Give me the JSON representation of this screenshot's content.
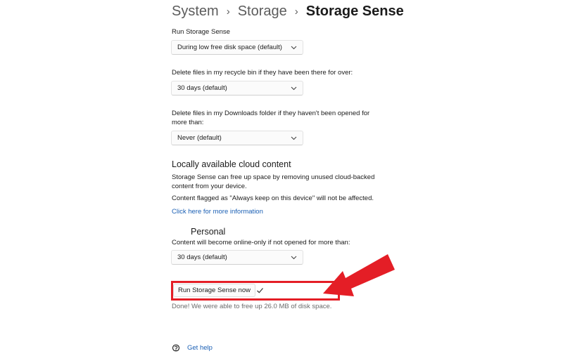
{
  "breadcrumb": {
    "items": [
      "System",
      "Storage"
    ],
    "current": "Storage Sense"
  },
  "run_storage_sense": {
    "label": "Run Storage Sense",
    "value": "During low free disk space (default)"
  },
  "recycle_bin": {
    "label": "Delete files in my recycle bin if they have been there for over:",
    "value": "30 days (default)"
  },
  "downloads": {
    "label_line1": "Delete files in my Downloads folder if they haven't been opened for",
    "label_line2": "more than:",
    "value": "Never (default)"
  },
  "cloud": {
    "title": "Locally available cloud content",
    "desc_line1": "Storage Sense can free up space by removing unused cloud-backed",
    "desc_line2": "content from your device.",
    "note": "Content flagged as \"Always keep on this device\" will not be affected.",
    "link": "Click here for more information"
  },
  "personal": {
    "title": "Personal",
    "label": "Content will become online-only if not opened for more than:",
    "value": "30 days (default)"
  },
  "run_now": {
    "button_label": "Run Storage Sense now",
    "status": "Done! We were able to free up 26.0 MB of disk space."
  },
  "footer": {
    "get_help": "Get help"
  },
  "colors": {
    "highlight": "#e41e26",
    "link": "#1a5fb4"
  },
  "icons": {
    "dropdown": "chevron-down-icon",
    "done": "checkmark-icon",
    "help": "help-icon",
    "annotation": "red-arrow"
  }
}
